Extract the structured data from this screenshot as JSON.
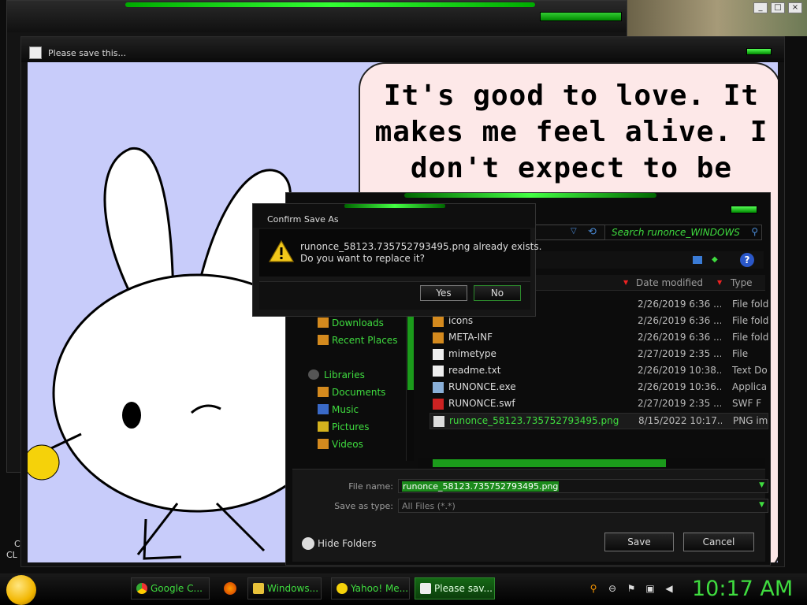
{
  "main_window": {
    "title": "Please save this...",
    "quote_lines": [
      "It's good to love. It",
      "makes me feel alive. I",
      "don't expect to be"
    ]
  },
  "photo_window": {
    "controls": [
      "_",
      "□",
      "×"
    ]
  },
  "desktop": {
    "icon_labels": [
      "C",
      "CL"
    ]
  },
  "save_dialog": {
    "search_placeholder": "Search runonce_WINDOWS",
    "help_icon": "?",
    "columns": {
      "date_modified": "Date modified",
      "type": "Type"
    },
    "nav": [
      {
        "label": "Downloads",
        "icon": "downloads-icon"
      },
      {
        "label": "Recent Places",
        "icon": "recent-places-icon"
      },
      {
        "label": "Libraries",
        "icon": "libraries-icon"
      },
      {
        "label": "Documents",
        "icon": "documents-icon"
      },
      {
        "label": "Music",
        "icon": "music-icon"
      },
      {
        "label": "Pictures",
        "icon": "pictures-icon"
      },
      {
        "label": "Videos",
        "icon": "videos-icon"
      }
    ],
    "files": [
      {
        "name": "",
        "date": "2/26/2019 6:36 ...",
        "type": "File fold"
      },
      {
        "name": "icons",
        "date": "2/26/2019 6:36 ...",
        "type": "File fold"
      },
      {
        "name": "META-INF",
        "date": "2/26/2019 6:36 ...",
        "type": "File fold"
      },
      {
        "name": "mimetype",
        "date": "2/27/2019 2:35 ...",
        "type": "File"
      },
      {
        "name": "readme.txt",
        "date": "2/26/2019 10:38...",
        "type": "Text Do"
      },
      {
        "name": "RUNONCE.exe",
        "date": "2/26/2019 10:36...",
        "type": "Applica"
      },
      {
        "name": "RUNONCE.swf",
        "date": "2/27/2019 2:35 ...",
        "type": "SWF F"
      },
      {
        "name": "runonce_58123.735752793495.png",
        "date": "8/15/2022 10:17...",
        "type": "PNG im"
      }
    ],
    "file_name_label": "File name:",
    "file_name_value": "runonce_58123.735752793495.png",
    "save_as_type_label": "Save as type:",
    "save_as_type_value": "All Files (*.*)",
    "hide_folders": "Hide Folders",
    "save_button": "Save",
    "cancel_button": "Cancel"
  },
  "confirm_dialog": {
    "title": "Confirm Save As",
    "message_line1": "runonce_58123.735752793495.png already exists.",
    "message_line2": "Do you want to replace it?",
    "yes_button": "Yes",
    "no_button": "No"
  },
  "taskbar": {
    "buttons": [
      {
        "label": "Google C...",
        "icon": "chrome-icon",
        "active": false
      },
      {
        "label": "Windows...",
        "icon": "folder-icon",
        "active": false
      },
      {
        "label": "Yahoo! Me...",
        "icon": "yahoo-messenger-icon",
        "active": false
      },
      {
        "label": "Please sav...",
        "icon": "paint-icon",
        "active": true
      }
    ],
    "clock": "10:17 AM"
  },
  "colors": {
    "accent_green": "#3fdc3f",
    "canvas_bg": "#c8ccfa",
    "speech_bg": "#fde8e8"
  }
}
